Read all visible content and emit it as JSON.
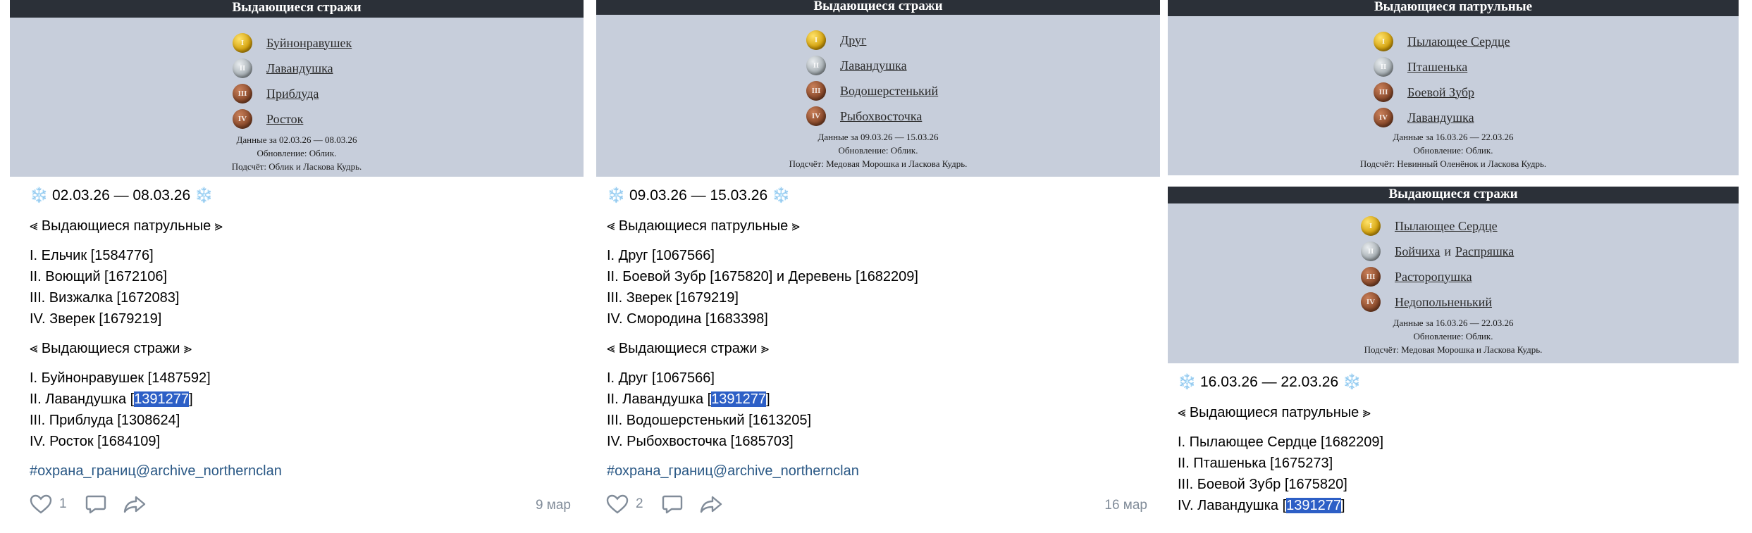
{
  "snow": "❄️",
  "col1": {
    "banner": {
      "title": "Выдающиеся стражи",
      "medals": [
        "Буйнонравушек",
        "Лавандушка",
        "Приблуда",
        "Росток"
      ],
      "info": [
        "Данные за 02.03.26 — 08.03.26",
        "Обновление: Облик.",
        "Подсчёт: Облик и Ласкова Кудрь."
      ]
    },
    "post": {
      "date_range": "02.03.26 — 08.03.26",
      "patrol_heading": "⪡ Выдающиеся патрульные ⪢",
      "patrol": [
        "I. Ельчик [1584776]",
        "II. Воющий [1672106]",
        "III. Визжалка [1672083]",
        "IV. Зверек [1679219]"
      ],
      "guard_heading": "⪡ Выдающиеся стражи ⪢",
      "guard": [
        {
          "pre": "I. Буйнонравушек [1487592]",
          "hl": "",
          "post": ""
        },
        {
          "pre": "II. Лавандушка [",
          "hl": "1391277",
          "post": "]"
        },
        {
          "pre": "III. Приблуда [1308624]",
          "hl": "",
          "post": ""
        },
        {
          "pre": "IV. Росток [1684109]",
          "hl": "",
          "post": ""
        }
      ],
      "tag": "#охрана_границ@archive_northernclan",
      "likes": "1",
      "date": "9 мар"
    }
  },
  "col2": {
    "banner": {
      "title": "Выдающиеся стражи",
      "medals": [
        "Друг",
        "Лавандушка",
        "Водошерстенький",
        "Рыбохвосточка"
      ],
      "info": [
        "Данные за 09.03.26 — 15.03.26",
        "Обновление: Облик.",
        "Подсчёт: Медовая Морошка и Ласкова Кудрь."
      ]
    },
    "post": {
      "date_range": "09.03.26 — 15.03.26",
      "patrol_heading": "⪡ Выдающиеся патрульные ⪢",
      "patrol": [
        "I. Друг [1067566]",
        "II. Боевой Зубр [1675820] и Деревень [1682209]",
        "III. Зверек [1679219]",
        "IV. Смородина [1683398]"
      ],
      "guard_heading": "⪡ Выдающиеся стражи ⪢",
      "guard": [
        {
          "pre": "I. Друг [1067566]",
          "hl": "",
          "post": ""
        },
        {
          "pre": "II. Лавандушка [",
          "hl": "1391277",
          "post": "]"
        },
        {
          "pre": "III. Водошерстенький [1613205]",
          "hl": "",
          "post": ""
        },
        {
          "pre": "IV. Рыбохвосточка [1685703]",
          "hl": "",
          "post": ""
        }
      ],
      "tag": "#охрана_границ@archive_northernclan",
      "likes": "2",
      "date": "16 мар"
    }
  },
  "col3": {
    "banner1": {
      "title": "Выдающиеся патрульные",
      "medals": [
        "Пылающее Сердце",
        "Пташенька",
        "Боевой Зубр",
        "Лавандушка"
      ],
      "info": [
        "Данные за 16.03.26 — 22.03.26",
        "Обновление: Облик.",
        "Подсчёт: Невинный Оленёнок и Ласкова Кудрь."
      ]
    },
    "banner2": {
      "title": "Выдающиеся стражи",
      "medal1": "Пылающее Сердце",
      "medal2a": "Бойчиха",
      "medal2conj": "и",
      "medal2b": "Распряшка",
      "medal3": "Расторопушка",
      "medal4": "Недопольненький",
      "info": [
        "Данные за 16.03.26 — 22.03.26",
        "Обновление: Облик.",
        "Подсчёт: Медовая Морошка и Ласкова Кудрь."
      ]
    },
    "post": {
      "date_range": "16.03.26 — 22.03.26",
      "patrol_heading": "⪡ Выдающиеся патрульные ⪢",
      "patrol": [
        {
          "pre": "I. Пылающее Сердце [1682209]",
          "hl": "",
          "post": ""
        },
        {
          "pre": "II. Пташенька [1675273]",
          "hl": "",
          "post": ""
        },
        {
          "pre": "III. Боевой Зубр [1675820]",
          "hl": "",
          "post": ""
        },
        {
          "pre": "IV. Лавандушка [",
          "hl": "1391277",
          "post": "]"
        }
      ]
    }
  },
  "medal_labels": [
    "I",
    "II",
    "III",
    "IV"
  ]
}
